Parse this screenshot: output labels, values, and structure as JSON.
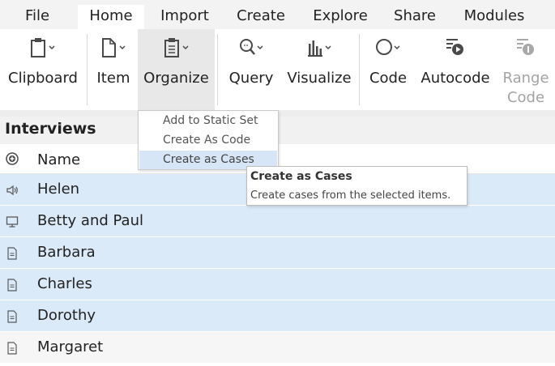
{
  "menu": {
    "tabs": [
      {
        "label": "File"
      },
      {
        "label": "Home"
      },
      {
        "label": "Import"
      },
      {
        "label": "Create"
      },
      {
        "label": "Explore"
      },
      {
        "label": "Share"
      },
      {
        "label": "Modules"
      }
    ],
    "active_tab": "Home"
  },
  "ribbon": {
    "groups": [
      {
        "label": "Clipboard",
        "icon": "clipboard-icon"
      },
      {
        "label": "Item",
        "icon": "document-icon"
      },
      {
        "label": "Organize",
        "icon": "organize-icon",
        "state": "pressed"
      },
      {
        "label": "Query",
        "icon": "magnifier-icon"
      },
      {
        "label": "Visualize",
        "icon": "bar-chart-icon"
      },
      {
        "label": "Code",
        "icon": "code-circle-icon"
      },
      {
        "label": "Autocode",
        "icon": "autocode-icon"
      },
      {
        "label_line1": "Range",
        "label_line2": "Code",
        "icon": "range-code-icon",
        "state": "disabled"
      }
    ]
  },
  "dropdown": {
    "items": [
      {
        "label": "Add to Static Set"
      },
      {
        "label": "Create As Code"
      },
      {
        "label": "Create as Cases",
        "state": "hover"
      }
    ]
  },
  "tooltip": {
    "title": "Create as Cases",
    "body": "Create cases from the selected items."
  },
  "list": {
    "title": "Interviews",
    "column_name": "Name",
    "rows": [
      {
        "name": "Helen",
        "icon": "audio-icon",
        "selected": true
      },
      {
        "name": "Betty and Paul",
        "icon": "video-icon",
        "selected": true
      },
      {
        "name": "Barbara",
        "icon": "document-icon",
        "selected": true
      },
      {
        "name": "Charles",
        "icon": "document-icon",
        "selected": true
      },
      {
        "name": "Dorothy",
        "icon": "document-icon",
        "selected": true
      },
      {
        "name": "Margaret",
        "icon": "document-icon",
        "selected": false
      }
    ]
  },
  "colors": {
    "selection": "#dbeaf8",
    "menu_highlight": "#d7e6f6",
    "disabled_text": "#a3a3a3"
  }
}
